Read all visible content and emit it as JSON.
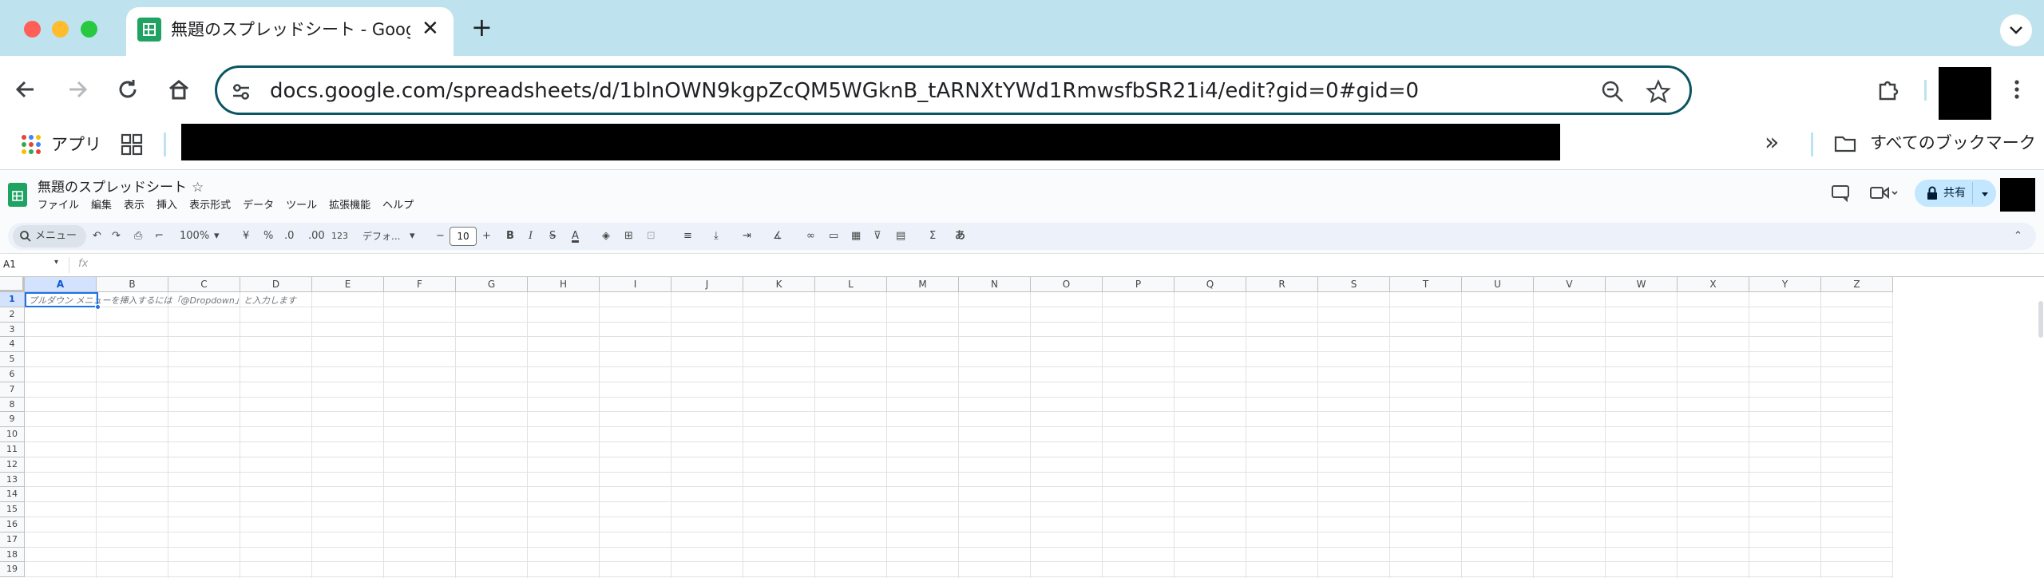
{
  "browser": {
    "tab_title": "無題のスプレッドシート - Google スプレッドシート",
    "tab_close": "✕",
    "new_tab": "+",
    "url": "docs.google.com/spreadsheets/d/1blnOWN9kgpZcQM5WGknB_tARNXtYWd1RmwsfbSR21i4/edit?gid=0#gid=0",
    "bookmarks": {
      "apps_label": "アプリ",
      "overflow": "»",
      "all_bookmarks": "すべてのブックマーク"
    }
  },
  "sheets": {
    "title": "無題のスプレッドシート",
    "menu": [
      "ファイル",
      "編集",
      "表示",
      "挿入",
      "表示形式",
      "データ",
      "ツール",
      "拡張機能",
      "ヘルプ"
    ],
    "toolbar": {
      "search": "メニュー",
      "zoom": "100%",
      "currency": "¥",
      "percent": "%",
      "dec_dec": ".0",
      "dec_inc": ".00",
      "num_format": "123",
      "font": "デフォ...",
      "font_minus": "−",
      "font_size": "10",
      "font_plus": "+",
      "bold": "B",
      "italic": "I",
      "strike": "S",
      "text_color": "A",
      "sum": "Σ",
      "input": "あ"
    },
    "share_label": "共有",
    "name_box": "A1",
    "fx": "fx",
    "cell_hint": "プルダウン メニューを挿入するには「@Dropdown」と入力します",
    "columns": [
      "A",
      "B",
      "C",
      "D",
      "E",
      "F",
      "G",
      "H",
      "I",
      "J",
      "K",
      "L",
      "M",
      "N",
      "O",
      "P",
      "Q",
      "R",
      "S",
      "T",
      "U",
      "V",
      "W",
      "X",
      "Y",
      "Z"
    ],
    "rows": [
      "1",
      "2",
      "3",
      "4",
      "5",
      "6",
      "7",
      "8",
      "9",
      "10",
      "11",
      "12",
      "13",
      "14",
      "15",
      "16",
      "17",
      "18",
      "19"
    ]
  },
  "colors": {
    "tabstrip": "#bfe3ee",
    "accent": "#0b57d0",
    "omnibox_border": "#0b5563",
    "sheets_green": "#1ea362",
    "share_bg": "#c2e7ff"
  }
}
